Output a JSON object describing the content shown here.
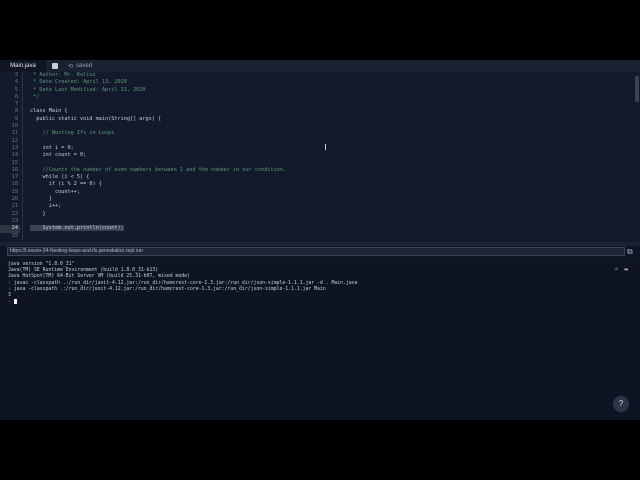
{
  "tabs": {
    "file": "Main.java",
    "status": "saved"
  },
  "code": [
    {
      "n": "3",
      "t": " * Author: Mr. Kalisz",
      "k": "comment"
    },
    {
      "n": "4",
      "t": " * Date Created: April 13, 2020",
      "k": "comment"
    },
    {
      "n": "5",
      "t": " * Date Last Modified: April 13, 2020",
      "k": "comment"
    },
    {
      "n": "6",
      "t": " */",
      "k": "comment"
    },
    {
      "n": "7",
      "t": "",
      "k": ""
    },
    {
      "n": "8",
      "t": "class Main {",
      "k": ""
    },
    {
      "n": "9",
      "t": "  public static void main(String[] args) {",
      "k": ""
    },
    {
      "n": "10",
      "t": "",
      "k": ""
    },
    {
      "n": "11",
      "t": "    // Nesting Ifs in Loops",
      "k": "comment"
    },
    {
      "n": "12",
      "t": "",
      "k": ""
    },
    {
      "n": "13",
      "t": "    int i = 0;",
      "k": ""
    },
    {
      "n": "14",
      "t": "    int count = 0;",
      "k": ""
    },
    {
      "n": "15",
      "t": "",
      "k": ""
    },
    {
      "n": "16",
      "t": "    //Counts the number of even numbers between 1 and the number in our condition.",
      "k": "comment"
    },
    {
      "n": "17",
      "t": "    while (i < 5) {",
      "k": ""
    },
    {
      "n": "18",
      "t": "      if (i % 2 == 0) {",
      "k": ""
    },
    {
      "n": "19",
      "t": "        count++;",
      "k": ""
    },
    {
      "n": "20",
      "t": "      }",
      "k": ""
    },
    {
      "n": "21",
      "t": "      i++;",
      "k": ""
    },
    {
      "n": "22",
      "t": "    }",
      "k": ""
    },
    {
      "n": "23",
      "t": "",
      "k": ""
    },
    {
      "n": "24",
      "t": "    System.out.println(count);",
      "k": "active"
    },
    {
      "n": "25",
      "t": "",
      "k": ""
    }
  ],
  "url": "https://Lesson-34-Nesting-loops-and-ifs.jameskalisz.repl.run",
  "console": [
    {
      "p": "",
      "t": "java version \"1.8.0_31\""
    },
    {
      "p": "",
      "t": "Java(TM) SE Runtime Environment (build 1.8.0_31-b13)"
    },
    {
      "p": "",
      "t": "Java HotSpot(TM) 64-Bit Server VM (build 25.31-b07, mixed mode)"
    },
    {
      "p": "›",
      "t": " javac -classpath .:/run_dir/junit-4.12.jar:/run_dir/hamcrest-core-1.3.jar:/run_dir/json-simple-1.1.1.jar -d . Main.java"
    },
    {
      "p": "›",
      "t": " java -classpath .:/run_dir/junit-4.12.jar:/run_dir/hamcrest-core-1.3.jar:/run_dir/json-simple-1.1.1.jar Main"
    },
    {
      "p": "",
      "t": "3"
    }
  ],
  "prompt": "›",
  "help": "?"
}
